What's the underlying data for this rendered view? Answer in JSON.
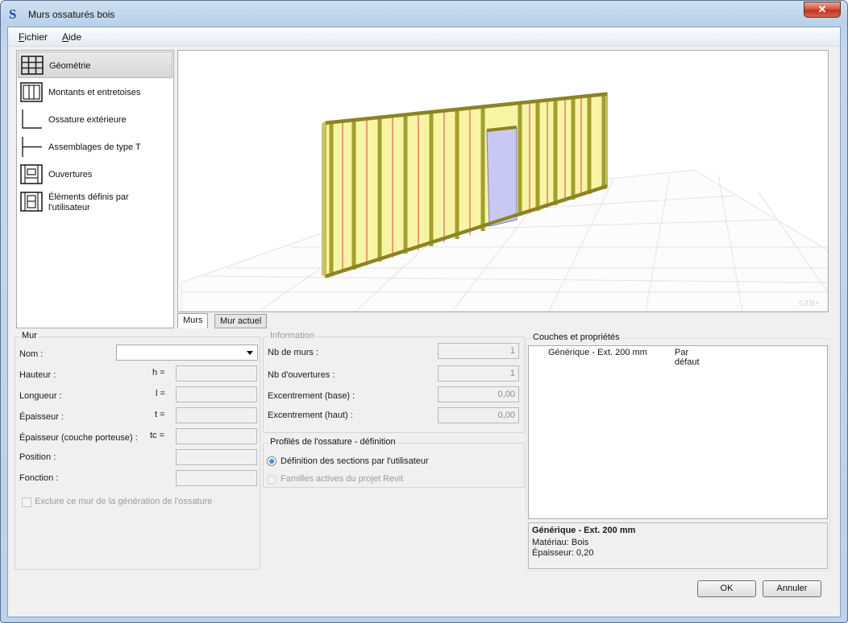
{
  "window": {
    "title": "Murs ossaturés bois",
    "app_icon": "S",
    "close_glyph": "✕"
  },
  "menu": {
    "fichier": {
      "key": "F",
      "rest": "ichier"
    },
    "aide": {
      "key": "A",
      "rest": "ide"
    }
  },
  "nav": {
    "items": [
      {
        "label": "Géométrie",
        "icon": "grid-frame-icon",
        "active": true
      },
      {
        "label": "Montants et entretoises",
        "icon": "studs-icon"
      },
      {
        "label": "Ossature extérieure",
        "icon": "corner-l-icon"
      },
      {
        "label": "Assemblages de type T",
        "icon": "t-joint-icon"
      },
      {
        "label": "Ouvertures",
        "icon": "opening-icon"
      },
      {
        "label": "Éléments définis par",
        "label2": "l'utilisateur",
        "icon": "user-elements-icon"
      }
    ]
  },
  "view": {
    "watermark": "GDI+",
    "tabs": {
      "murs": "Murs",
      "actuel": "Mur actuel"
    }
  },
  "mur": {
    "title": "Mur",
    "nom_label": "Nom :",
    "nom_value": "",
    "hauteur_label": "Hauteur :",
    "hauteur_sym": "h =",
    "longueur_label": "Longueur :",
    "longueur_sym": "l =",
    "epaisseur_label": "Épaisseur :",
    "epaisseur_sym": "t =",
    "epaisseur_cp_label": "Épaisseur (couche porteuse) :",
    "epaisseur_cp_sym": "tc =",
    "position_label": "Position :",
    "fonction_label": "Fonction :",
    "exclure_label": "Exclure ce mur de la génération de l'ossature"
  },
  "information": {
    "title": "Information",
    "nb_murs_label": "Nb de murs :",
    "nb_murs": "1",
    "nb_ouv_label": "Nb d'ouvertures :",
    "nb_ouv": "1",
    "exc_base_label": "Excentrement (base) :",
    "exc_base": "0,00",
    "exc_haut_label": "Excentrement (haut) :",
    "exc_haut": "0,00"
  },
  "profils": {
    "title": "Profilés de l'ossature - définition",
    "opt1": "Définition des sections par l'utilisateur",
    "opt2": "Familles actives du projet Revit"
  },
  "couches": {
    "title": "Couches et propriétés",
    "row_name": "Générique - Ext. 200 mm",
    "row_value": "Par défaut",
    "detail_title": "Générique - Ext. 200 mm",
    "detail_materiau": "Matériau: Bois",
    "detail_epaisseur": "Épaisseur: 0,20"
  },
  "buttons": {
    "ok": "OK",
    "annuler": "Annuler"
  }
}
